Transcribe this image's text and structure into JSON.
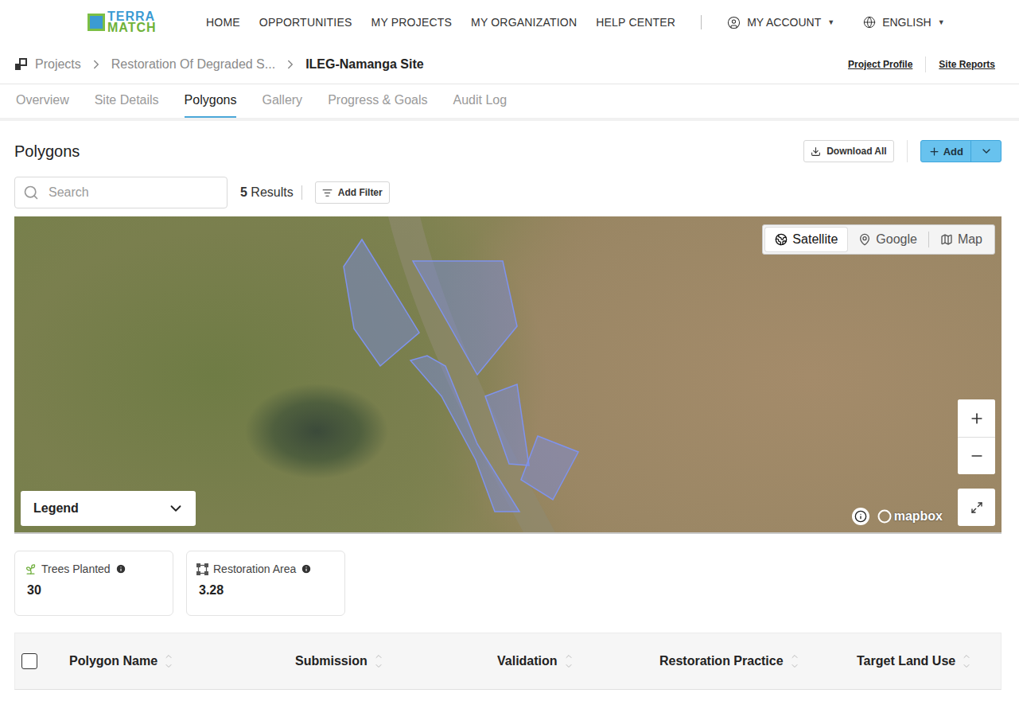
{
  "logo": {
    "line1": "TERRA",
    "line2": "MATCH"
  },
  "nav": {
    "items": [
      "HOME",
      "OPPORTUNITIES",
      "MY PROJECTS",
      "MY ORGANIZATION",
      "HELP CENTER"
    ],
    "account": "MY ACCOUNT",
    "language": "ENGLISH",
    "caret": "▼"
  },
  "breadcrumb": {
    "items": [
      "Projects",
      "Restoration Of Degraded S...",
      "ILEG-Namanga Site"
    ]
  },
  "header_links": [
    "Project Profile",
    "Site Reports"
  ],
  "tabs": [
    {
      "label": "Overview",
      "selected": false
    },
    {
      "label": "Site Details",
      "selected": false
    },
    {
      "label": "Polygons",
      "selected": true
    },
    {
      "label": "Gallery",
      "selected": false
    },
    {
      "label": "Progress & Goals",
      "selected": false
    },
    {
      "label": "Audit Log",
      "selected": false
    }
  ],
  "section": {
    "title": "Polygons",
    "download": "Download All",
    "add": "Add"
  },
  "search": {
    "placeholder": "Search",
    "count": "5",
    "count_label": "Results",
    "filter": "Add Filter"
  },
  "map": {
    "layers": [
      {
        "label": "Satellite",
        "selected": true
      },
      {
        "label": "Google",
        "selected": false
      },
      {
        "label": "Map",
        "selected": false
      }
    ],
    "legend": "Legend",
    "attribution": "mapbox"
  },
  "stats": [
    {
      "label": "Trees Planted",
      "value": "30"
    },
    {
      "label": "Restoration Area",
      "value": "3.28"
    }
  ],
  "table": {
    "select_all_checked": false,
    "columns": [
      "Polygon Name",
      "Submission",
      "Validation",
      "Restoration Practice",
      "Target Land Use"
    ]
  }
}
